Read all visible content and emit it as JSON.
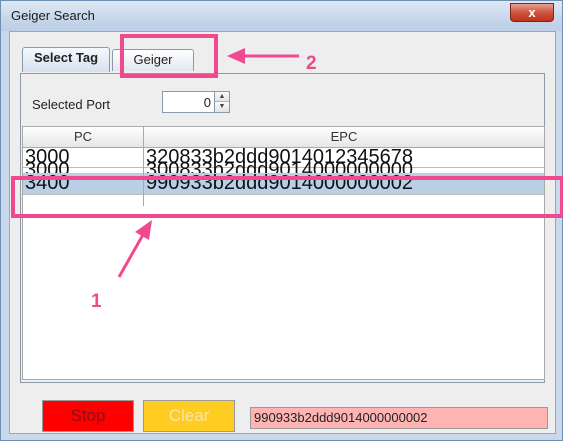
{
  "window": {
    "title": "Geiger Search",
    "close_glyph": "x"
  },
  "tabs": [
    {
      "label": "Select Tag",
      "active": true
    },
    {
      "label": "Geiger",
      "active": false
    }
  ],
  "port": {
    "label": "Selected Port",
    "value": "0",
    "up_glyph": "▲",
    "down_glyph": "▼"
  },
  "table": {
    "columns": [
      "PC",
      "EPC"
    ],
    "rows": [
      {
        "pc": "3000",
        "epc": "320833b2ddd9014012345678",
        "selected": false
      },
      {
        "pc": "3000",
        "epc": "300833b2ddd9014000000000",
        "selected": false
      },
      {
        "pc": "3400",
        "epc": "990933b2ddd9014000000002",
        "selected": true
      }
    ]
  },
  "buttons": {
    "stop": "Stop",
    "clear": "Clear"
  },
  "epc_display": "990933b2ddd9014000000002",
  "annotations": {
    "label_1": "1",
    "label_2": "2",
    "color": "#ef4a8f"
  }
}
